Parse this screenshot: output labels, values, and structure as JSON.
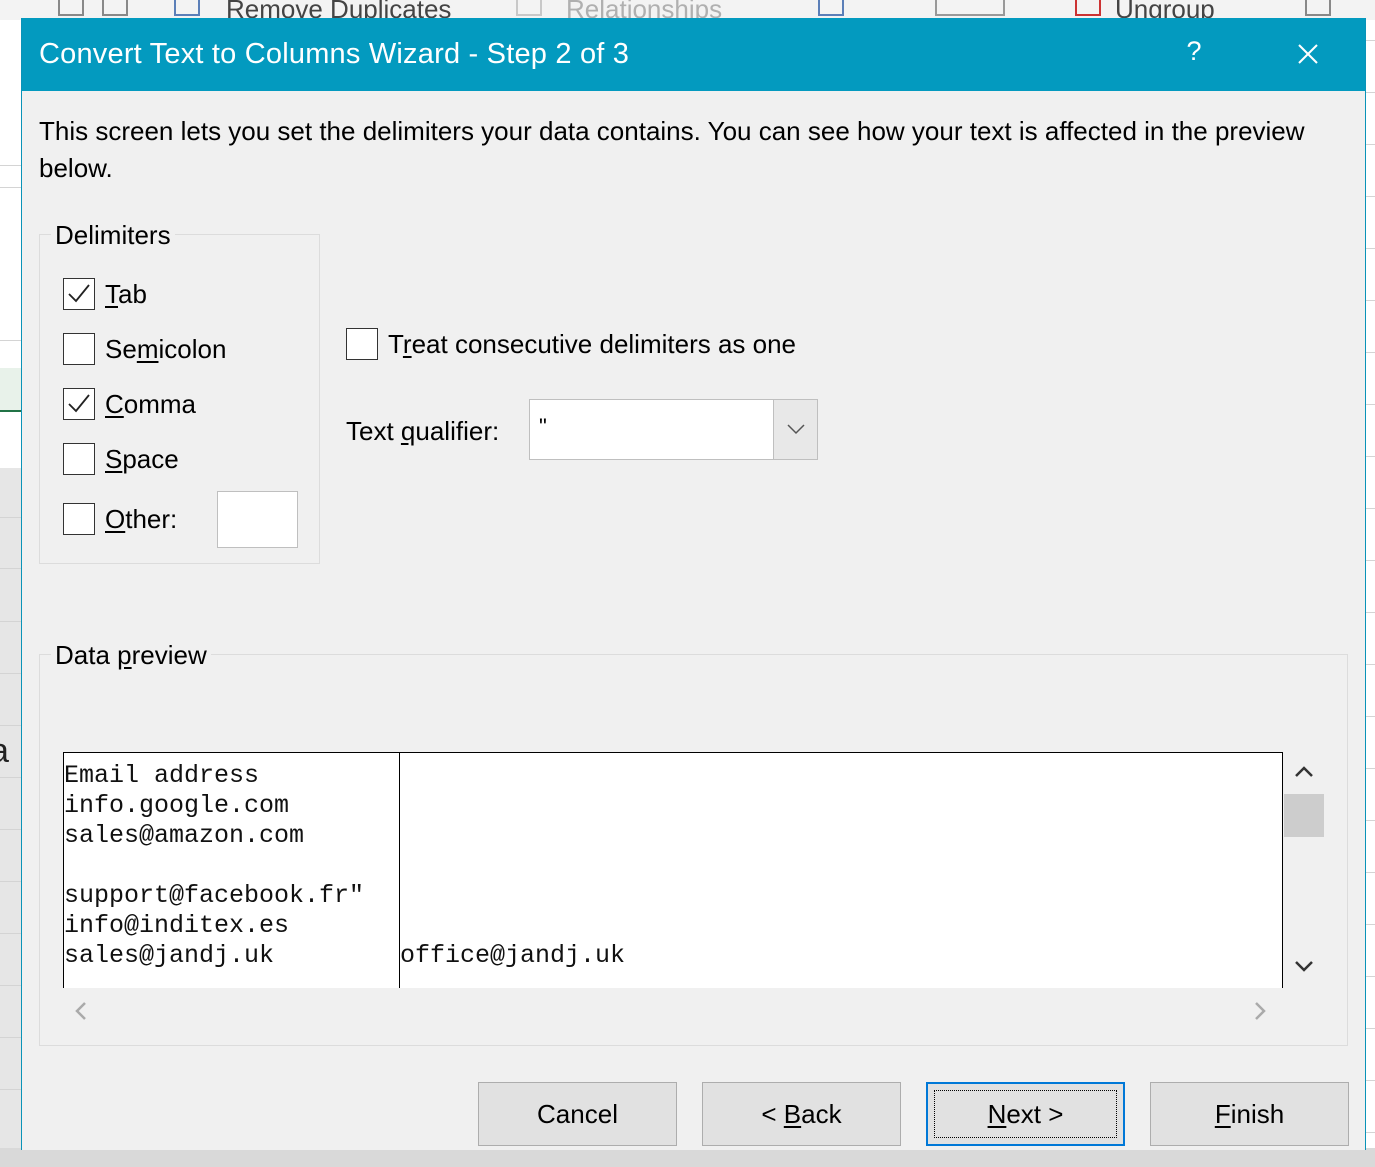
{
  "background": {
    "ribbon_items": [
      "Remove Duplicates",
      "Relationships",
      "Ungroup"
    ]
  },
  "dialog": {
    "title": "Convert Text to Columns Wizard - Step 2 of 3",
    "help_label": "?",
    "description": "This screen lets you set the delimiters your data contains.  You can see how your text is affected in the preview below.",
    "delimiters": {
      "legend": "Delimiters",
      "options": [
        {
          "label": "Tab",
          "mnemonic": "T",
          "checked": true
        },
        {
          "label": "Semicolon",
          "mnemonic": "m",
          "checked": false
        },
        {
          "label": "Comma",
          "mnemonic": "C",
          "checked": true
        },
        {
          "label": "Space",
          "mnemonic": "S",
          "checked": false
        },
        {
          "label": "Other:",
          "mnemonic": "O",
          "checked": false
        }
      ],
      "other_value": ""
    },
    "consecutive": {
      "label": "Treat consecutive delimiters as one",
      "checked": false
    },
    "text_qualifier": {
      "label": "Text qualifier:",
      "value": "\""
    },
    "preview": {
      "legend": "Data preview",
      "rows": [
        [
          "Email address",
          ""
        ],
        [
          "info.google.com",
          ""
        ],
        [
          "sales@amazon.com",
          ""
        ],
        [
          "",
          ""
        ],
        [
          "support@facebook.fr\"",
          ""
        ],
        [
          "info@inditex.es",
          ""
        ],
        [
          "sales@jandj.uk",
          "office@jandj.uk"
        ]
      ]
    },
    "buttons": {
      "cancel": "Cancel",
      "back": "< Back",
      "next": "Next >",
      "finish": "Finish"
    }
  }
}
